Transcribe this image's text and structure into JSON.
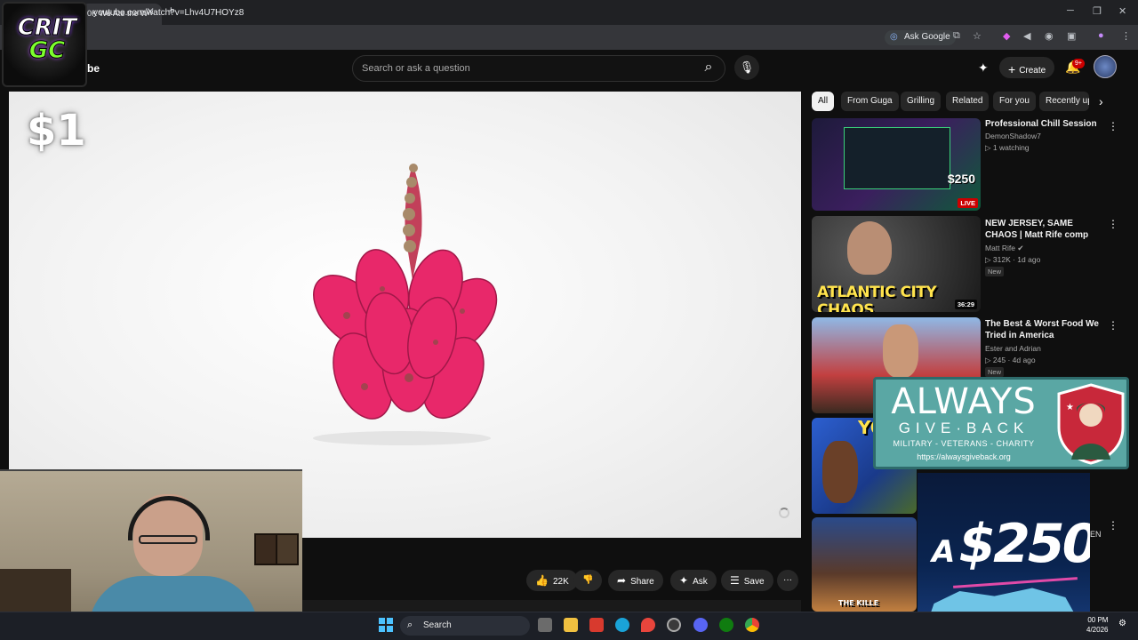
{
  "browser": {
    "tab_title": "0K We Ate the W",
    "tab_close": "✕",
    "new_tab": "+",
    "url": "youtube.com/watch?v=Lhv4U7HOYz8",
    "ask_google": "Ask Google",
    "window_controls": [
      "─",
      "❐",
      "✕"
    ]
  },
  "overlay_logo": {
    "line1": "CRIT",
    "line2": "GC"
  },
  "youtube": {
    "brand_fragment": "be",
    "search_placeholder": "Search or ask a question",
    "create_label": "Create",
    "notification_count": "9+"
  },
  "video": {
    "price_overlay": "$1",
    "actions": {
      "like_count": "22K",
      "share": "Share",
      "ask": "Ask",
      "save": "Save",
      "more": "···"
    }
  },
  "chips": [
    "All",
    "From Guga",
    "Grilling",
    "Related",
    "For you",
    "Recently up"
  ],
  "recommendations": [
    {
      "title": "Professional Chill Session",
      "channel": "DemonShadow7",
      "meta": "▷ 1 watching",
      "badge": "LIVE",
      "thumb_colors": [
        "#1d1a3a",
        "#3b1f5e",
        "#0f5a3a"
      ]
    },
    {
      "title": "NEW JERSEY, SAME CHAOS | Matt Rife comp",
      "channel": "Matt Rife ✔",
      "meta": "▷ 312K · 1d ago",
      "badge": "New",
      "duration": "36:29",
      "thumb_text": "ATLANTIC CITY CHAOS"
    },
    {
      "title": "The Best & Worst Food We Tried in America",
      "channel": "Ester and Adrian",
      "meta": "▷ 245 · 4d ago",
      "badge": "New"
    },
    {
      "title": "",
      "thumb_text": "YO M"
    },
    {
      "title": "EN",
      "thumb_text": "THE KILLE"
    }
  ],
  "always_give_back": {
    "line1": "ALWAYS",
    "line2": "GIVE·BACK",
    "subtitle": "MILITARY - VETERANS - CHARITY",
    "url": "https://alwaysgiveback.org"
  },
  "promo": {
    "prefix": "A",
    "amount": "$250"
  },
  "taskbar": {
    "search_label": "Search",
    "clock_time": "00 PM",
    "clock_date": "4/2026"
  },
  "colors": {
    "youtube_bg": "#0f0f0f",
    "live_red": "#cc0000",
    "fruit_pink": "#e8286a",
    "windows_blue": "#4cc2ff",
    "agb_teal": "#5aa7a4"
  }
}
